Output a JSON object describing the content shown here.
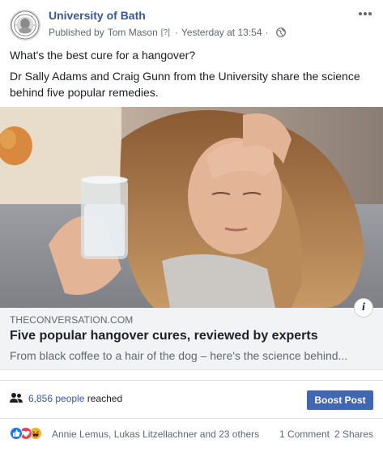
{
  "post": {
    "page_name": "University of Bath",
    "published_prefix": "Published by",
    "publisher": "Tom Mason",
    "help_marker": "[?]",
    "separator": "·",
    "timestamp": "Yesterday at 13:54",
    "audience_icon": "globe-icon",
    "text_line1": "What's the best cure for a hangover?",
    "text_line2": "Dr Sally Adams and Craig Gunn from the University share the science behind five popular remedies."
  },
  "link_preview": {
    "domain": "THECONVERSATION.COM",
    "title": "Five popular hangover cures, reviewed by experts",
    "description": "From black coffee to a hair of the dog – here's the science behind...",
    "info_label": "i"
  },
  "reach": {
    "count": "6,856 people",
    "suffix": "reached",
    "boost_label": "Boost Post"
  },
  "reactions": {
    "icons": [
      "like-icon",
      "love-icon",
      "haha-icon"
    ],
    "names": "Annie Lemus, Lukas Litzellachner and 23 others",
    "comments": "1 Comment",
    "shares": "2 Shares"
  },
  "colors": {
    "link_blue": "#385898",
    "boost_blue": "#4267b2",
    "meta_gray": "#606770",
    "like_blue": "#1877f2",
    "love_red": "#f33e58",
    "haha_yellow": "#f7b125"
  }
}
